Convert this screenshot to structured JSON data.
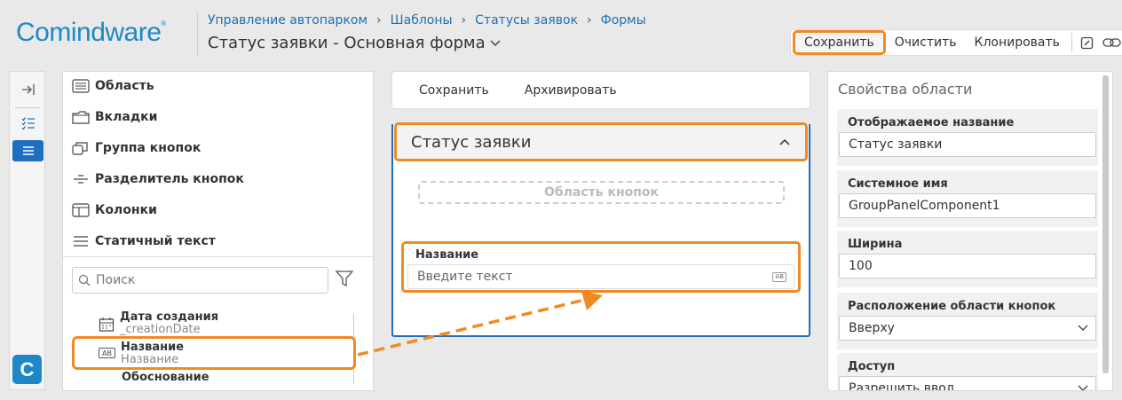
{
  "brand": {
    "logo": "Comindware",
    "registered": "®"
  },
  "breadcrumbs": [
    "Управление автопарком",
    "Шаблоны",
    "Статусы заявок",
    "Формы"
  ],
  "breadcrumb_separator": "›",
  "page_title": "Статус заявки - Основная форма",
  "toolbar": {
    "save": "Сохранить",
    "clear": "Очистить",
    "clone": "Клонировать",
    "icons": [
      "edit-icon",
      "link-icon"
    ]
  },
  "rail": {
    "icons": [
      "collapse-panel-icon",
      "checklist-icon",
      "list-icon"
    ],
    "logo_letter": "C"
  },
  "palette": {
    "items": [
      {
        "label": "Область",
        "icon": "area-icon"
      },
      {
        "label": "Вкладки",
        "icon": "folder-tabs-icon"
      },
      {
        "label": "Группа кнопок",
        "icon": "button-group-icon"
      },
      {
        "label": "Разделитель кнопок",
        "icon": "button-separator-icon"
      },
      {
        "label": "Колонки",
        "icon": "columns-icon"
      },
      {
        "label": "Статичный текст",
        "icon": "static-text-icon"
      }
    ],
    "search_placeholder": "Поиск",
    "fields": [
      {
        "title": "Дата создания",
        "system": "_creationDate",
        "icon": "calendar-icon"
      },
      {
        "title": "Название",
        "system": "Название",
        "icon": "text-field-icon",
        "badge": "AB"
      },
      {
        "title": "Обоснование",
        "system": ""
      }
    ]
  },
  "form": {
    "actions": [
      "Сохранить",
      "Архивировать"
    ],
    "panel_title": "Статус заявки",
    "button_area": "Область кнопок",
    "field_label": "Название",
    "field_placeholder": "Введите текст",
    "field_badge": "AB"
  },
  "properties": {
    "title": "Свойства области",
    "display_name_label": "Отображаемое название",
    "display_name": "Статус заявки",
    "system_name_label": "Системное имя",
    "system_name": "GroupPanelComponent1",
    "width_label": "Ширина",
    "width": "100",
    "button_area_position_label": "Расположение области кнопок",
    "button_area_position": "Вверху",
    "access_label": "Доступ",
    "access": "Разрешить ввод"
  },
  "colors": {
    "accent": "#1e6fbf",
    "highlight": "#f08a24",
    "brand": "#1e88c7"
  }
}
